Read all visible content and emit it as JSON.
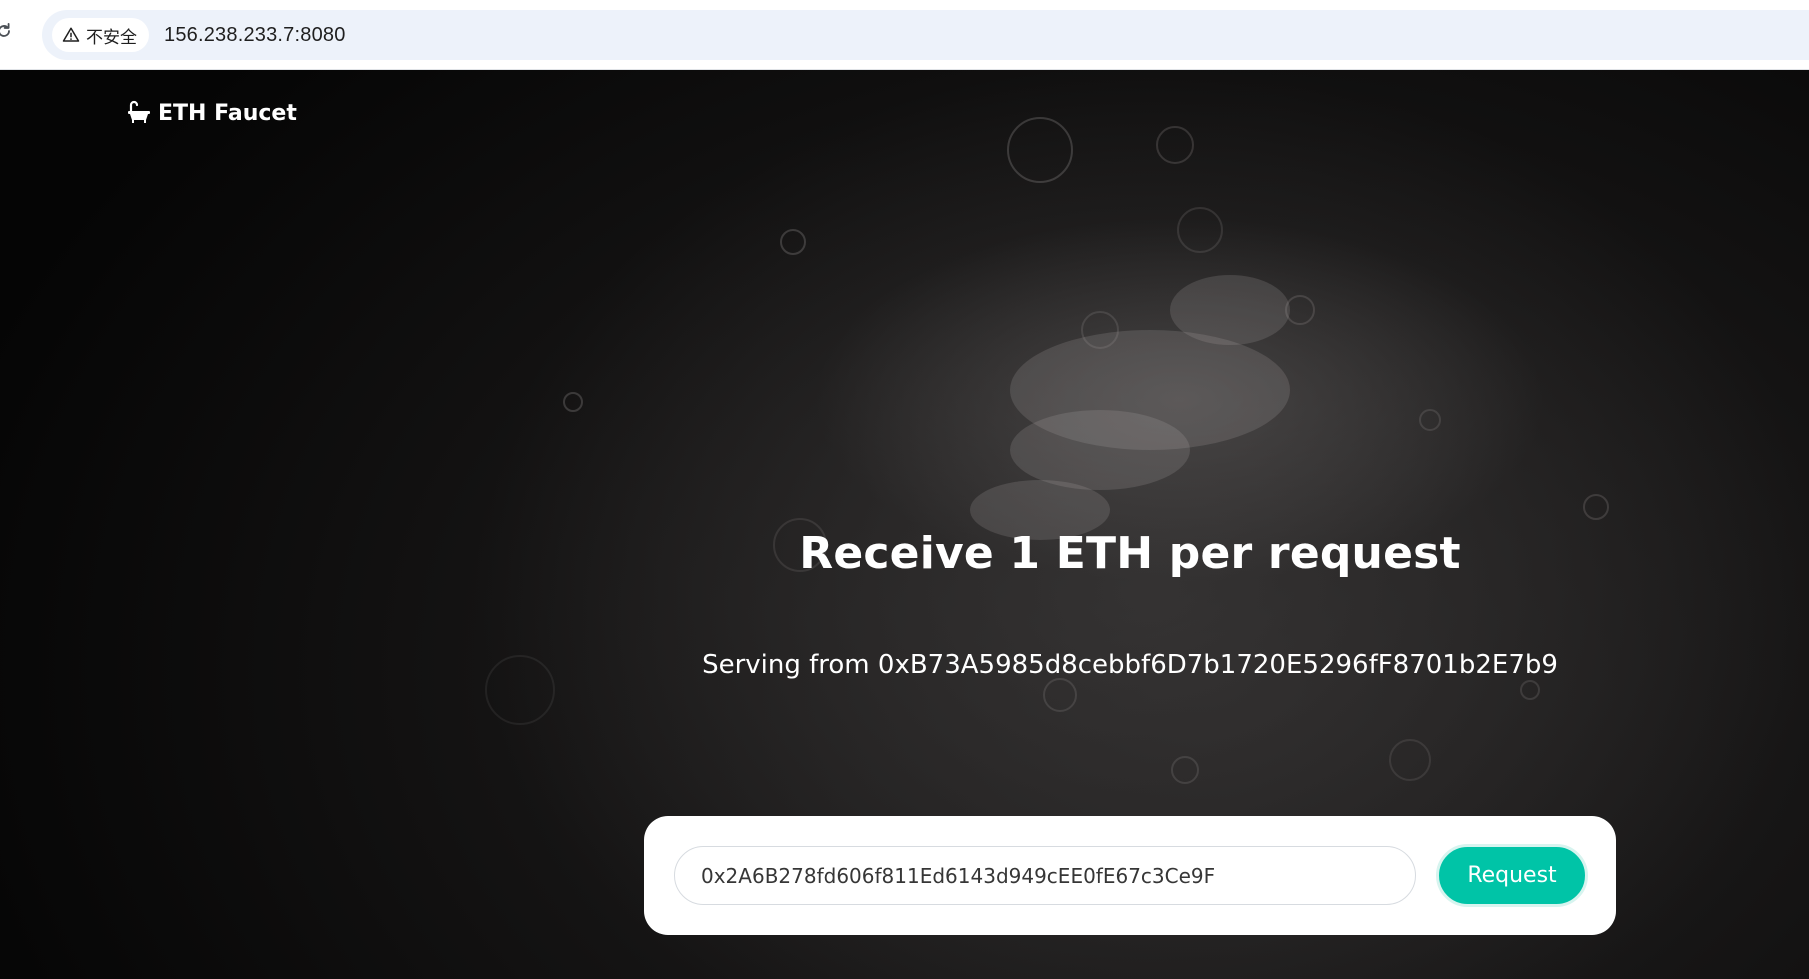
{
  "browser": {
    "security_label": "不安全",
    "url": "156.238.233.7:8080"
  },
  "navbar": {
    "brand_text": "ETH Faucet",
    "brand_icon": "bathtub-icon"
  },
  "hero": {
    "title": "Receive 1 ETH per request",
    "serving_text": "Serving from 0xB73A5985d8cebbf6D7b1720E5296fF8701b2E7b9"
  },
  "request_form": {
    "address_value": "0x2A6B278fd606f811Ed6143d949cEE0fE67c3Ce9F",
    "button_label": "Request"
  },
  "colors": {
    "accent": "#00c4a7",
    "background": "#141313",
    "card": "#ffffff"
  }
}
